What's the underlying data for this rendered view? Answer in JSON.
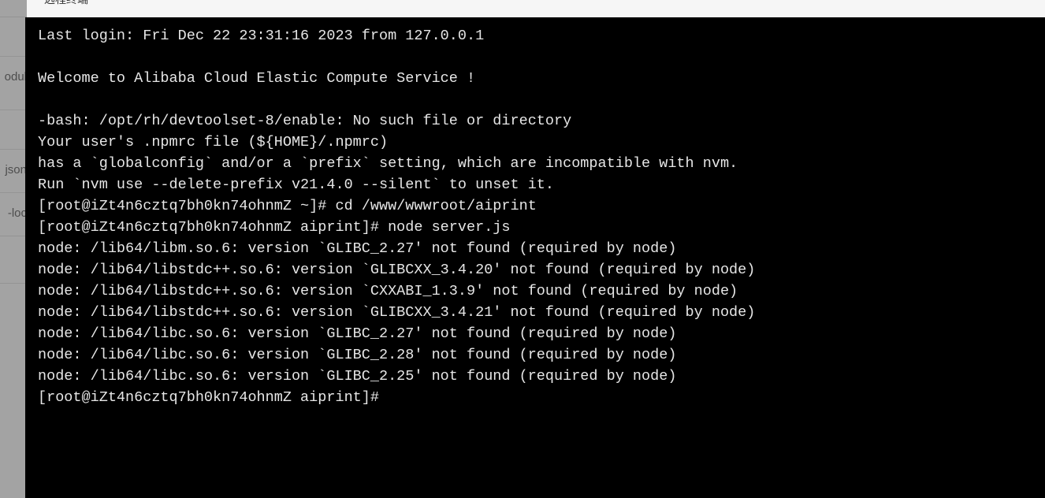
{
  "window": {
    "tab_title": "远程终端"
  },
  "file_explorer": {
    "rows": [
      {
        "label": ""
      },
      {
        "label": ""
      },
      {
        "label": "odul"
      },
      {
        "label": ""
      },
      {
        "label": "json"
      },
      {
        "label": "-loc"
      },
      {
        "label": ""
      },
      {
        "label": ""
      }
    ]
  },
  "terminal": {
    "background_color": "#000000",
    "foreground_color": "#e6e6e6",
    "lines": [
      "Last login: Fri Dec 22 23:31:16 2023 from 127.0.0.1",
      "",
      "Welcome to Alibaba Cloud Elastic Compute Service !",
      "",
      "-bash: /opt/rh/devtoolset-8/enable: No such file or directory",
      "Your user's .npmrc file (${HOME}/.npmrc)",
      "has a `globalconfig` and/or a `prefix` setting, which are incompatible with nvm.",
      "Run `nvm use --delete-prefix v21.4.0 --silent` to unset it.",
      "[root@iZt4n6cztq7bh0kn74ohnmZ ~]# cd /www/wwwroot/aiprint",
      "[root@iZt4n6cztq7bh0kn74ohnmZ aiprint]# node server.js",
      "node: /lib64/libm.so.6: version `GLIBC_2.27' not found (required by node)",
      "node: /lib64/libstdc++.so.6: version `GLIBCXX_3.4.20' not found (required by node)",
      "node: /lib64/libstdc++.so.6: version `CXXABI_1.3.9' not found (required by node)",
      "node: /lib64/libstdc++.so.6: version `GLIBCXX_3.4.21' not found (required by node)",
      "node: /lib64/libc.so.6: version `GLIBC_2.27' not found (required by node)",
      "node: /lib64/libc.so.6: version `GLIBC_2.28' not found (required by node)",
      "node: /lib64/libc.so.6: version `GLIBC_2.25' not found (required by node)",
      "[root@iZt4n6cztq7bh0kn74ohnmZ aiprint]# "
    ]
  }
}
